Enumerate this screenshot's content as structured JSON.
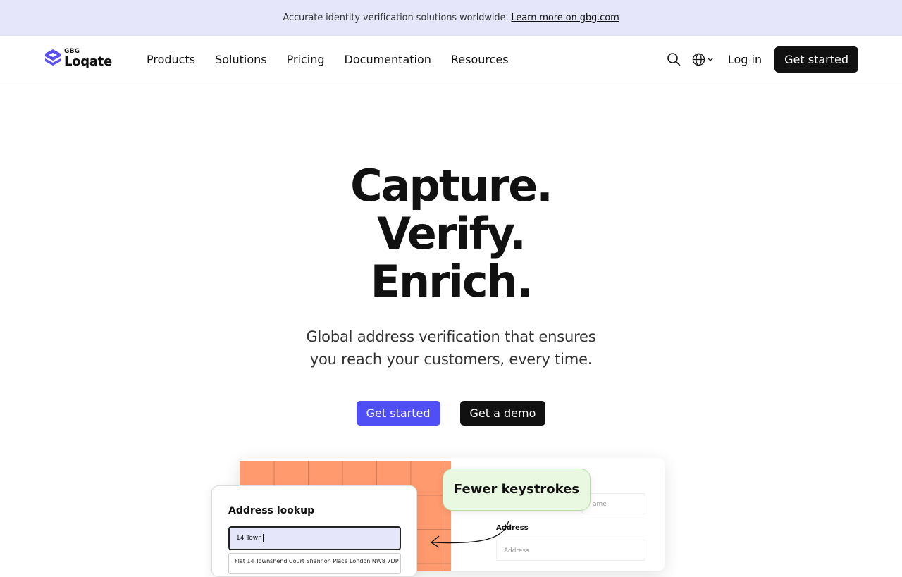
{
  "banner": {
    "text": "Accurate identity verification solutions worldwide.",
    "link": "Learn more on gbg.com"
  },
  "brand": {
    "parent": "GBG",
    "name": "Loqate",
    "accent_color": "#5a4ff0"
  },
  "nav": {
    "items": [
      {
        "label": "Products"
      },
      {
        "label": "Solutions"
      },
      {
        "label": "Pricing"
      },
      {
        "label": "Documentation"
      },
      {
        "label": "Resources"
      }
    ],
    "search_icon": "search-icon",
    "globe_icon": "globe-icon",
    "login": "Log in",
    "get_started": "Get started"
  },
  "hero": {
    "line1": "Capture.",
    "line2": "Verify.",
    "line3": "Enrich.",
    "sub1": "Global address verification that ensures",
    "sub2": "you reach your customers, every time.",
    "primary_cta": "Get started",
    "secondary_cta": "Get a demo",
    "primary_color": "#4f4ff5"
  },
  "illustration": {
    "card_title": "Address lookup",
    "input_value": "14 Town",
    "result": "Flat 14 Townshend Court Shannon Place London NW8 7DP",
    "bubble": "Fewer keystrokes",
    "field_label": "Address",
    "field_placeholder": "Address",
    "field_partial": "ame",
    "orange_color": "#ff9a6e",
    "bubble_color": "#e8f8e1"
  }
}
